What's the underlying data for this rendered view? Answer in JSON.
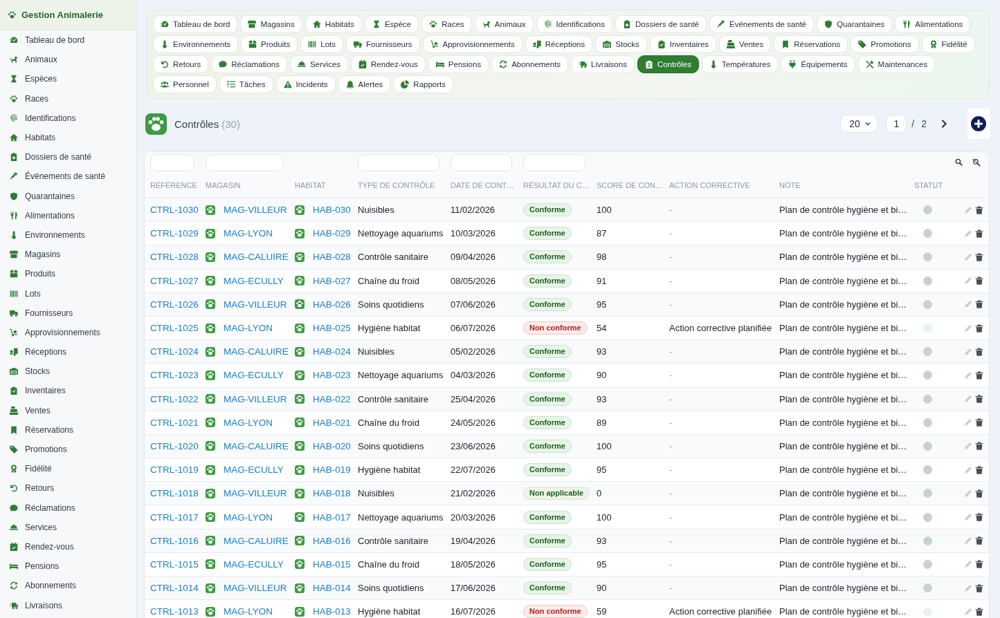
{
  "app": {
    "title": "Gestion Animalerie"
  },
  "sidebar": {
    "items": [
      {
        "label": "Tableau de bord"
      },
      {
        "label": "Animaux"
      },
      {
        "label": "Espèces"
      },
      {
        "label": "Races"
      },
      {
        "label": "Identifications"
      },
      {
        "label": "Habitats"
      },
      {
        "label": "Dossiers de santé"
      },
      {
        "label": "Événements de santé"
      },
      {
        "label": "Quarantaines"
      },
      {
        "label": "Alimentations"
      },
      {
        "label": "Environnements"
      },
      {
        "label": "Magasins"
      },
      {
        "label": "Produits"
      },
      {
        "label": "Lots"
      },
      {
        "label": "Fournisseurs"
      },
      {
        "label": "Approvisionnements"
      },
      {
        "label": "Réceptions"
      },
      {
        "label": "Stocks"
      },
      {
        "label": "Inventaires"
      },
      {
        "label": "Ventes"
      },
      {
        "label": "Réservations"
      },
      {
        "label": "Promotions"
      },
      {
        "label": "Fidélité"
      },
      {
        "label": "Retours"
      },
      {
        "label": "Réclamations"
      },
      {
        "label": "Services"
      },
      {
        "label": "Rendez-vous"
      },
      {
        "label": "Pensions"
      },
      {
        "label": "Abonnements"
      },
      {
        "label": "Livraisons"
      }
    ]
  },
  "tabs": [
    {
      "label": "Tableau de bord",
      "selected": false
    },
    {
      "label": "Magasins",
      "selected": false
    },
    {
      "label": "Habitats",
      "selected": false
    },
    {
      "label": "Espèce",
      "selected": false
    },
    {
      "label": "Races",
      "selected": false
    },
    {
      "label": "Animaux",
      "selected": false
    },
    {
      "label": "Identifications",
      "selected": false
    },
    {
      "label": "Dossiers de santé",
      "selected": false
    },
    {
      "label": "Événements de santé",
      "selected": false
    },
    {
      "label": "Quarantaines",
      "selected": false
    },
    {
      "label": "Alimentations",
      "selected": false
    },
    {
      "label": "Environnements",
      "selected": false
    },
    {
      "label": "Produits",
      "selected": false
    },
    {
      "label": "Lots",
      "selected": false
    },
    {
      "label": "Fournisseurs",
      "selected": false
    },
    {
      "label": "Approvisionnements",
      "selected": false
    },
    {
      "label": "Réceptions",
      "selected": false
    },
    {
      "label": "Stocks",
      "selected": false
    },
    {
      "label": "Inventaires",
      "selected": false
    },
    {
      "label": "Ventes",
      "selected": false
    },
    {
      "label": "Réservations",
      "selected": false
    },
    {
      "label": "Promotions",
      "selected": false
    },
    {
      "label": "Fidélité",
      "selected": false
    },
    {
      "label": "Retours",
      "selected": false
    },
    {
      "label": "Réclamations",
      "selected": false
    },
    {
      "label": "Services",
      "selected": false
    },
    {
      "label": "Rendez-vous",
      "selected": false
    },
    {
      "label": "Pensions",
      "selected": false
    },
    {
      "label": "Abonnements",
      "selected": false
    },
    {
      "label": "Livraisons",
      "selected": false
    },
    {
      "label": "Contrôles",
      "selected": true
    },
    {
      "label": "Températures",
      "selected": false
    },
    {
      "label": "Équipements",
      "selected": false
    },
    {
      "label": "Maintenances",
      "selected": false
    },
    {
      "label": "Personnel",
      "selected": false
    },
    {
      "label": "Tâches",
      "selected": false
    },
    {
      "label": "Incidents",
      "selected": false
    },
    {
      "label": "Alertes",
      "selected": false
    },
    {
      "label": "Rapports",
      "selected": false
    }
  ],
  "header": {
    "title": "Contrôles",
    "count": "(30)",
    "page_size": "20",
    "page": "1",
    "separator": "/",
    "total_pages": "2"
  },
  "table": {
    "columns": [
      {
        "label": "RÉFÉRENCE",
        "filter": true
      },
      {
        "label": "MAGASIN",
        "filter": true
      },
      {
        "label": "HABITAT",
        "filter": false
      },
      {
        "label": "TYPE DE CONTRÔLE",
        "filter": true
      },
      {
        "label": "DATE DE CONT…",
        "filter": true
      },
      {
        "label": "RÉSULTAT DU C…",
        "filter": true
      },
      {
        "label": "SCORE DE CON…",
        "filter": false
      },
      {
        "label": "ACTION CORRECTIVE",
        "filter": false
      },
      {
        "label": "NOTE",
        "filter": false
      },
      {
        "label": "STATUT",
        "filter": false
      }
    ],
    "rows": [
      {
        "reference": "CTRL-1030",
        "store": "MAG-VILLEUR",
        "habitat": "HAB-030",
        "type": "Nuisibles",
        "date": "11/02/2026",
        "result": {
          "label": "Conforme",
          "kind": "ok"
        },
        "score": "100",
        "action": "-",
        "action_muted": true,
        "note": "Plan de contrôle hygiène et bi…",
        "status": {
          "color": "#c9d1cd"
        }
      },
      {
        "reference": "CTRL-1029",
        "store": "MAG-LYON",
        "habitat": "HAB-029",
        "type": "Nettoyage aquariums",
        "date": "10/03/2026",
        "result": {
          "label": "Conforme",
          "kind": "ok"
        },
        "score": "87",
        "action": "-",
        "action_muted": true,
        "note": "Plan de contrôle hygiène et bi…",
        "status": {
          "color": "#c9d1cd"
        }
      },
      {
        "reference": "CTRL-1028",
        "store": "MAG-CALUIRE",
        "habitat": "HAB-028",
        "type": "Contrôle sanitaire",
        "date": "09/04/2026",
        "result": {
          "label": "Conforme",
          "kind": "ok"
        },
        "score": "98",
        "action": "-",
        "action_muted": true,
        "note": "Plan de contrôle hygiène et bi…",
        "status": {
          "color": "#c9d1cd"
        }
      },
      {
        "reference": "CTRL-1027",
        "store": "MAG-ECULLY",
        "habitat": "HAB-027",
        "type": "Chaîne du froid",
        "date": "08/05/2026",
        "result": {
          "label": "Conforme",
          "kind": "ok"
        },
        "score": "91",
        "action": "-",
        "action_muted": true,
        "note": "Plan de contrôle hygiène et bi…",
        "status": {
          "color": "#c9d1cd"
        }
      },
      {
        "reference": "CTRL-1026",
        "store": "MAG-VILLEUR",
        "habitat": "HAB-026",
        "type": "Soins quotidiens",
        "date": "07/06/2026",
        "result": {
          "label": "Conforme",
          "kind": "ok"
        },
        "score": "95",
        "action": "-",
        "action_muted": true,
        "note": "Plan de contrôle hygiène et bi…",
        "status": {
          "color": "#c9d1cd"
        }
      },
      {
        "reference": "CTRL-1025",
        "store": "MAG-LYON",
        "habitat": "HAB-025",
        "type": "Hygiène habitat",
        "date": "06/07/2026",
        "result": {
          "label": "Non conforme",
          "kind": "fail"
        },
        "score": "54",
        "action": "Action corrective planifiée",
        "action_muted": false,
        "note": "Plan de contrôle hygiène et bi…",
        "status": {
          "color": "#e3f5e9"
        }
      },
      {
        "reference": "CTRL-1024",
        "store": "MAG-CALUIRE",
        "habitat": "HAB-024",
        "type": "Nuisibles",
        "date": "05/02/2026",
        "result": {
          "label": "Conforme",
          "kind": "ok"
        },
        "score": "93",
        "action": "-",
        "action_muted": true,
        "note": "Plan de contrôle hygiène et bi…",
        "status": {
          "color": "#c9d1cd"
        }
      },
      {
        "reference": "CTRL-1023",
        "store": "MAG-ECULLY",
        "habitat": "HAB-023",
        "type": "Nettoyage aquariums",
        "date": "04/03/2026",
        "result": {
          "label": "Conforme",
          "kind": "ok"
        },
        "score": "90",
        "action": "-",
        "action_muted": true,
        "note": "Plan de contrôle hygiène et bi…",
        "status": {
          "color": "#c9d1cd"
        }
      },
      {
        "reference": "CTRL-1022",
        "store": "MAG-VILLEUR",
        "habitat": "HAB-022",
        "type": "Contrôle sanitaire",
        "date": "25/04/2026",
        "result": {
          "label": "Conforme",
          "kind": "ok"
        },
        "score": "93",
        "action": "-",
        "action_muted": true,
        "note": "Plan de contrôle hygiène et bi…",
        "status": {
          "color": "#c9d1cd"
        }
      },
      {
        "reference": "CTRL-1021",
        "store": "MAG-LYON",
        "habitat": "HAB-021",
        "type": "Chaîne du froid",
        "date": "24/05/2026",
        "result": {
          "label": "Conforme",
          "kind": "ok"
        },
        "score": "89",
        "action": "-",
        "action_muted": true,
        "note": "Plan de contrôle hygiène et bi…",
        "status": {
          "color": "#c9d1cd"
        }
      },
      {
        "reference": "CTRL-1020",
        "store": "MAG-CALUIRE",
        "habitat": "HAB-020",
        "type": "Soins quotidiens",
        "date": "23/06/2026",
        "result": {
          "label": "Conforme",
          "kind": "ok"
        },
        "score": "100",
        "action": "-",
        "action_muted": true,
        "note": "Plan de contrôle hygiène et bi…",
        "status": {
          "color": "#c9d1cd"
        }
      },
      {
        "reference": "CTRL-1019",
        "store": "MAG-ECULLY",
        "habitat": "HAB-019",
        "type": "Hygiène habitat",
        "date": "22/07/2026",
        "result": {
          "label": "Conforme",
          "kind": "ok"
        },
        "score": "95",
        "action": "-",
        "action_muted": true,
        "note": "Plan de contrôle hygiène et bi…",
        "status": {
          "color": "#c9d1cd"
        }
      },
      {
        "reference": "CTRL-1018",
        "store": "MAG-VILLEUR",
        "habitat": "HAB-018",
        "type": "Nuisibles",
        "date": "21/02/2026",
        "result": {
          "label": "Non applicable",
          "kind": "na"
        },
        "score": "0",
        "action": "-",
        "action_muted": true,
        "note": "Plan de contrôle hygiène et bi…",
        "status": {
          "color": "#c9d1cd"
        }
      },
      {
        "reference": "CTRL-1017",
        "store": "MAG-LYON",
        "habitat": "HAB-017",
        "type": "Nettoyage aquariums",
        "date": "20/03/2026",
        "result": {
          "label": "Conforme",
          "kind": "ok"
        },
        "score": "100",
        "action": "-",
        "action_muted": true,
        "note": "Plan de contrôle hygiène et bi…",
        "status": {
          "color": "#c9d1cd"
        }
      },
      {
        "reference": "CTRL-1016",
        "store": "MAG-CALUIRE",
        "habitat": "HAB-016",
        "type": "Contrôle sanitaire",
        "date": "19/04/2026",
        "result": {
          "label": "Conforme",
          "kind": "ok"
        },
        "score": "93",
        "action": "-",
        "action_muted": true,
        "note": "Plan de contrôle hygiène et bi…",
        "status": {
          "color": "#c9d1cd"
        }
      },
      {
        "reference": "CTRL-1015",
        "store": "MAG-ECULLY",
        "habitat": "HAB-015",
        "type": "Chaîne du froid",
        "date": "18/05/2026",
        "result": {
          "label": "Conforme",
          "kind": "ok"
        },
        "score": "95",
        "action": "-",
        "action_muted": true,
        "note": "Plan de contrôle hygiène et bi…",
        "status": {
          "color": "#c9d1cd"
        }
      },
      {
        "reference": "CTRL-1014",
        "store": "MAG-VILLEUR",
        "habitat": "HAB-014",
        "type": "Soins quotidiens",
        "date": "17/06/2026",
        "result": {
          "label": "Conforme",
          "kind": "ok"
        },
        "score": "90",
        "action": "-",
        "action_muted": true,
        "note": "Plan de contrôle hygiène et bi…",
        "status": {
          "color": "#c9d1cd"
        }
      },
      {
        "reference": "CTRL-1013",
        "store": "MAG-LYON",
        "habitat": "HAB-013",
        "type": "Hygiène habitat",
        "date": "16/07/2026",
        "result": {
          "label": "Non conforme",
          "kind": "fail"
        },
        "score": "59",
        "action": "Action corrective planifiée",
        "action_muted": false,
        "note": "Plan de contrôle hygiène et bi…",
        "status": {
          "color": "#e3f5e9"
        }
      }
    ]
  }
}
